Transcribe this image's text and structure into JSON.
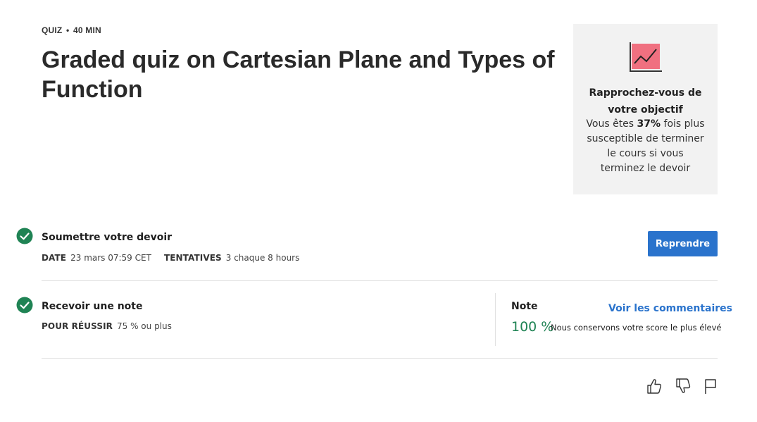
{
  "header": {
    "type_label": "QUIZ",
    "separator": "•",
    "duration": "40  MIN",
    "title": "Graded quiz on Cartesian Plane and Types of Function"
  },
  "goal_card": {
    "title": "Rapprochez-vous de votre objectif",
    "body_prefix": "Vous êtes ",
    "body_highlight": "37%",
    "body_suffix": " fois plus susceptible de terminer le cours si vous terminez le devoir",
    "icon": "trend-chart-icon",
    "accent_color": "#f07080"
  },
  "submit_step": {
    "title": "Soumettre votre devoir",
    "date_label": "DATE",
    "date_value": "23 mars 07:59 CET",
    "attempts_label": "TENTATIVES",
    "attempts_value": "3 chaque 8  hours",
    "button_label": "Reprendre",
    "status_icon": "check-circle-icon",
    "status_color": "#1f8354"
  },
  "grade_step": {
    "title": "Recevoir une note",
    "pass_label": "POUR RÉUSSIR",
    "pass_value": "75 % ou plus",
    "grade_label": "Note",
    "grade_value": "100 %",
    "grade_note": "Nous conservons votre score le plus élevé",
    "feedback_link": "Voir les commentaires",
    "status_icon": "check-circle-icon"
  },
  "footer_actions": [
    "thumbs-up-icon",
    "thumbs-down-icon",
    "flag-icon"
  ],
  "colors": {
    "primary": "#2a73cc",
    "success": "#1f8354"
  }
}
